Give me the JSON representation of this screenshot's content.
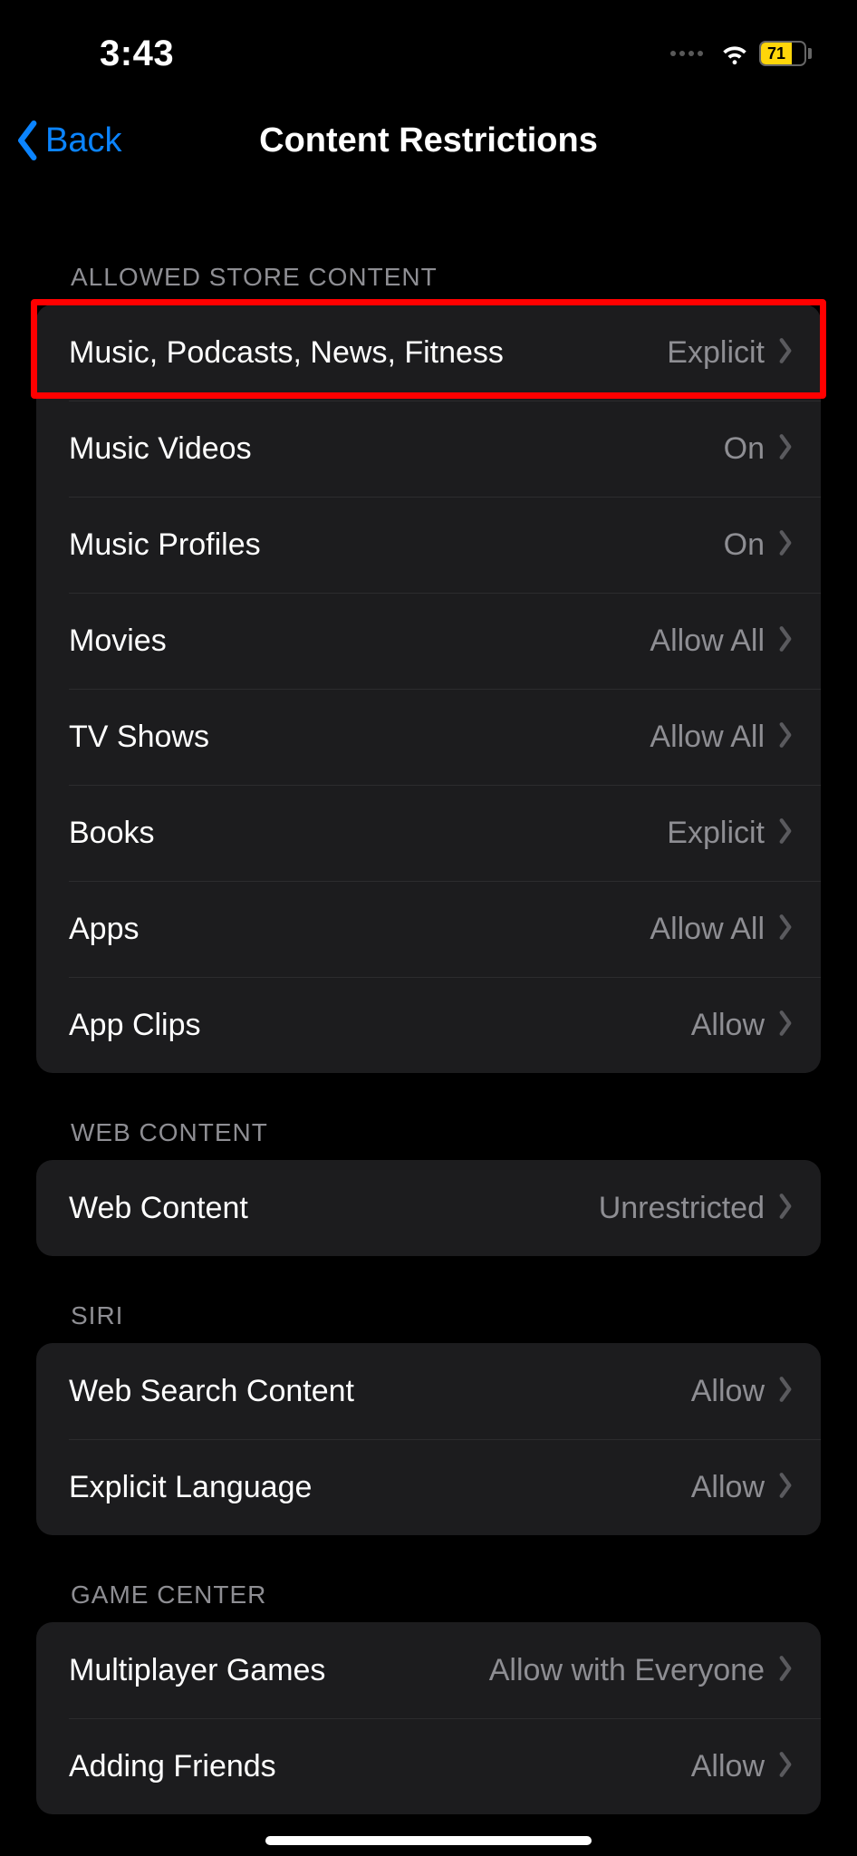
{
  "status": {
    "time": "3:43",
    "battery": "71"
  },
  "nav": {
    "back": "Back",
    "title": "Content Restrictions"
  },
  "sections": [
    {
      "header": "ALLOWED STORE CONTENT",
      "rows": [
        {
          "label": "Music, Podcasts, News, Fitness",
          "value": "Explicit"
        },
        {
          "label": "Music Videos",
          "value": "On"
        },
        {
          "label": "Music Profiles",
          "value": "On"
        },
        {
          "label": "Movies",
          "value": "Allow All"
        },
        {
          "label": "TV Shows",
          "value": "Allow All"
        },
        {
          "label": "Books",
          "value": "Explicit"
        },
        {
          "label": "Apps",
          "value": "Allow All"
        },
        {
          "label": "App Clips",
          "value": "Allow"
        }
      ]
    },
    {
      "header": "WEB CONTENT",
      "rows": [
        {
          "label": "Web Content",
          "value": "Unrestricted"
        }
      ]
    },
    {
      "header": "SIRI",
      "rows": [
        {
          "label": "Web Search Content",
          "value": "Allow"
        },
        {
          "label": "Explicit Language",
          "value": "Allow"
        }
      ]
    },
    {
      "header": "GAME CENTER",
      "rows": [
        {
          "label": "Multiplayer Games",
          "value": "Allow with Everyone"
        },
        {
          "label": "Adding Friends",
          "value": "Allow"
        }
      ]
    }
  ]
}
